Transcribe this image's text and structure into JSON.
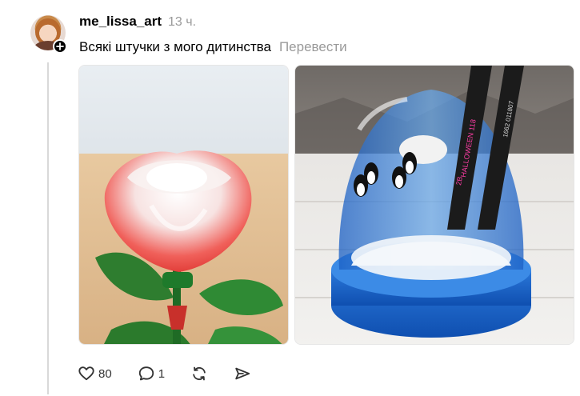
{
  "post": {
    "author": {
      "username": "me_lissa_art"
    },
    "timestamp": "13 ч.",
    "text": "Всякі штучки з мого дитинства",
    "translate_label": "Перевести",
    "media": [
      {
        "name": "rose-photo",
        "pencil_text": []
      },
      {
        "name": "snow-globe-photo",
        "pencil_text": [
          "HALLOWEEN 118",
          "2B",
          "1662 011807"
        ]
      }
    ],
    "actions": {
      "like_count": "80",
      "reply_count": "1"
    }
  },
  "colors": {
    "text": "#000000",
    "muted": "#9a9a9a",
    "thread_line": "#d9d9d9"
  },
  "icons": [
    "plus-icon",
    "heart-icon",
    "comment-icon",
    "repost-icon",
    "share-icon"
  ]
}
